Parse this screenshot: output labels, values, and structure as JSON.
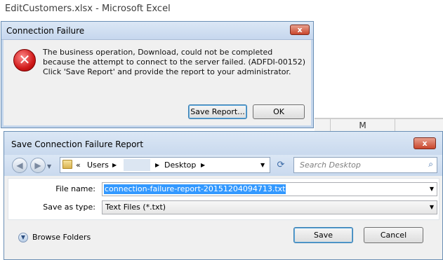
{
  "excel": {
    "title": "EditCustomers.xlsx  -  Microsoft Excel",
    "col_m": "M"
  },
  "conn_dialog": {
    "title": "Connection Failure",
    "close": "x",
    "icon": "error-icon",
    "message": "The business operation, Download, could not be completed because the attempt to connect to the server failed. (ADFDI-00152) Click 'Save Report' and provide the report to your administrator.",
    "save_report": "Save Report...",
    "ok": "OK"
  },
  "save_dialog": {
    "title": "Save Connection Failure Report",
    "close": "x",
    "breadcrumb": {
      "prefix": "«",
      "users": "Users",
      "desktop": "Desktop"
    },
    "search_placeholder": "Search Desktop",
    "file_name_label": "File name:",
    "file_name_value": "connection-failure-report-20151204094713.txt",
    "save_as_type_label": "Save as type:",
    "save_as_type_value": "Text Files (*.txt)",
    "browse_folders": "Browse Folders",
    "save": "Save",
    "cancel": "Cancel"
  }
}
